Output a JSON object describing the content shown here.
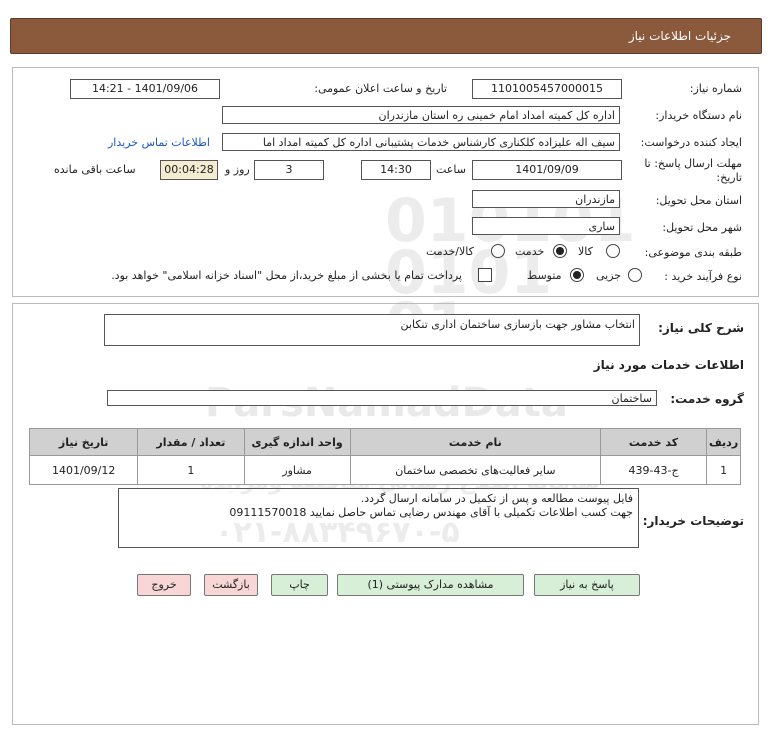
{
  "header": {
    "title": "جزئیات اطلاعات نیاز"
  },
  "form": {
    "need_number_label": "شماره نیاز:",
    "need_number": "1101005457000015",
    "announce_label": "تاریخ و ساعت اعلان عمومی:",
    "announce_value": "1401/09/06 - 14:21",
    "buyer_org_label": "نام دستگاه خریدار:",
    "buyer_org": "اداره کل کمیته امداد امام خمینی  ره  استان مازندران",
    "creator_label": "ایجاد کننده درخواست:",
    "creator": "سیف اله علیزاده کلکناری کارشناس خدمات پشتیبانی اداره کل کمیته امداد اما",
    "contact_link": "اطلاعات تماس خریدار",
    "deadline_label": "مهلت ارسال پاسخ: تا تاریخ:",
    "deadline_date": "1401/09/09",
    "time_label": "ساعت",
    "deadline_time": "14:30",
    "days_value": "3",
    "days_label": "روز و",
    "remaining_time": "00:04:28",
    "remaining_label": "ساعت باقی مانده",
    "province_label": "استان محل تحویل:",
    "province": "مازندران",
    "city_label": "شهر محل تحویل:",
    "city": "ساری",
    "category_label": "طبقه بندی موضوعی:",
    "category_options": [
      "کالا",
      "خدمت",
      "کالا/خدمت"
    ],
    "process_label": "نوع فرآیند خرید :",
    "process_options": [
      "جزیی",
      "متوسط"
    ],
    "payment_note": "پرداخت تمام یا بخشی از مبلغ خرید،از محل \"اسناد خزانه اسلامی\" خواهد بود."
  },
  "summary": {
    "label": "شرح کلی نیاز:",
    "value": "انتخاب مشاور جهت بازسازی ساختمان اداری تنکابن"
  },
  "services_title": "اطلاعات خدمات مورد نیاز",
  "group": {
    "label": "گروه خدمت:",
    "value": "ساختمان"
  },
  "table": {
    "headers": [
      "ردیف",
      "کد خدمت",
      "نام خدمت",
      "واحد اندازه گیری",
      "تعداد / مقدار",
      "تاریخ نیاز"
    ],
    "rows": [
      [
        "1",
        "ج-43-439",
        "سایر فعالیت‌های تخصصی ساختمان",
        "مشاور",
        "1",
        "1401/09/12"
      ]
    ]
  },
  "notes": {
    "label": "توضیحات خریدار:",
    "line1": "فایل پیوست مطالعه و پس از تکمیل در سامانه ارسال گردد.",
    "line2": "جهت کسب اطلاعات تکمیلی با آقای مهندس رضایی تماس حاصل نمایید 09111570018"
  },
  "buttons": {
    "reply": "پاسخ به نیاز",
    "attachments": "مشاهده مدارک پیوستی (1)",
    "print": "چاپ",
    "back": "بازگشت",
    "exit": "خروج"
  },
  "watermark": {
    "brand": "ParsNamadData",
    "fa_line1": "مرکز فرآوری اطلاعات پارس نماد داده",
    "fa_line2": "سامانه اطلاع رسانی مناقصه ومزایده",
    "phone": "۰۲۱-۸۸۳۴۹۶۷۰-۵"
  }
}
